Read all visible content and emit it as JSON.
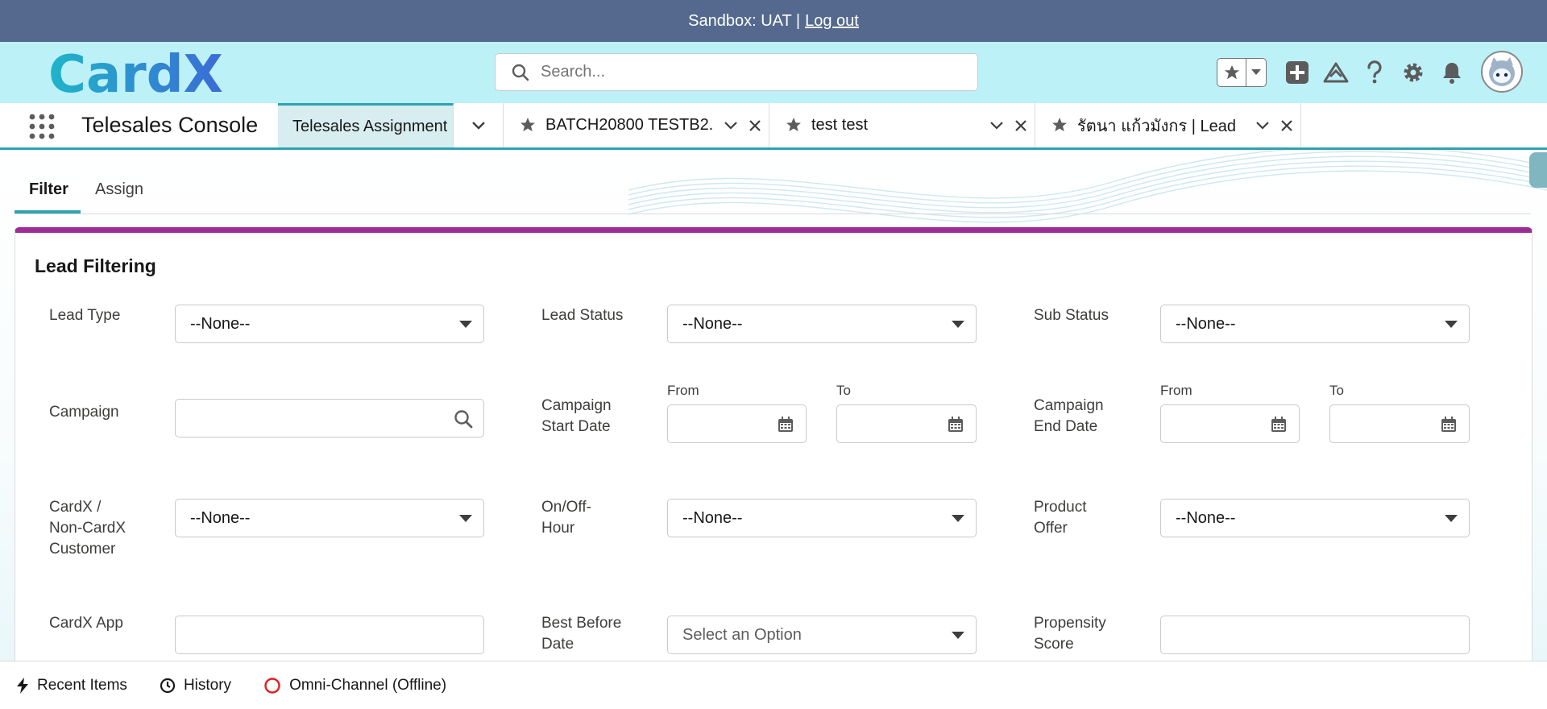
{
  "sandbox_bar": {
    "label": "Sandbox: UAT |",
    "logout_link": "Log out"
  },
  "global_header": {
    "logo_text": "CardX",
    "search": {
      "placeholder": "Search..."
    },
    "actions": [
      "favorites-star",
      "favorites-dropdown",
      "global-actions-plus",
      "trailhead-guidance",
      "help",
      "setup-gear",
      "notifications-bell",
      "user-avatar"
    ]
  },
  "console_nav": {
    "app_name": "Telesales Console",
    "tabs": [
      {
        "label": "Telesales Assignment",
        "active": true
      },
      {
        "label": "BATCH20800 TESTB2...",
        "icon": "lead-icon"
      },
      {
        "label": "test test",
        "icon": "lead-icon"
      },
      {
        "label": "รัตนา แก้วมังกร | Lead",
        "icon": "lead-icon"
      }
    ]
  },
  "sub_tabs": {
    "filter": "Filter",
    "assign": "Assign",
    "active": "Filter"
  },
  "lead_filtering": {
    "title": "Lead Filtering",
    "from_label": "From",
    "to_label": "To",
    "fields": {
      "lead_type": {
        "label": "Lead Type",
        "value": "--None--"
      },
      "lead_status": {
        "label": "Lead Status",
        "value": "--None--"
      },
      "sub_status": {
        "label": "Sub Status",
        "value": "--None--"
      },
      "campaign": {
        "label": "Campaign",
        "value": ""
      },
      "campaign_start_date": {
        "label_line1": "Campaign",
        "label_line2": "Start Date",
        "from": "",
        "to": ""
      },
      "campaign_end_date": {
        "label_line1": "Campaign",
        "label_line2": "End Date",
        "from": "",
        "to": ""
      },
      "cardx_customer": {
        "label_line1": "CardX /",
        "label_line2": "Non-CardX",
        "label_line3": "Customer",
        "value": "--None--"
      },
      "on_off_hour": {
        "label_line1": "On/Off-",
        "label_line2": "Hour",
        "value": "--None--"
      },
      "product_offer": {
        "label_line1": "Product",
        "label_line2": "Offer",
        "value": "--None--"
      },
      "cardx_app": {
        "label": "CardX App",
        "value": ""
      },
      "best_before_date": {
        "label_line1": "Best Before",
        "label_line2": "Date",
        "placeholder": "Select an Option"
      },
      "propensity_score": {
        "label_line1": "Propensity",
        "label_line2": "Score",
        "value": ""
      }
    }
  },
  "utility_bar": {
    "recent_items": "Recent Items",
    "history": "History",
    "omni_channel": "Omni-Channel (Offline)"
  },
  "colors": {
    "sandbox_bar": "#54698d",
    "header_bg": "#bdf1f8",
    "accent_teal": "#2fa2b0",
    "card_top_border": "#9c2d95",
    "logo_gradient_start": "#1fb5c9",
    "logo_gradient_end": "#3c6bd6",
    "omni_offline": "#e02020"
  }
}
